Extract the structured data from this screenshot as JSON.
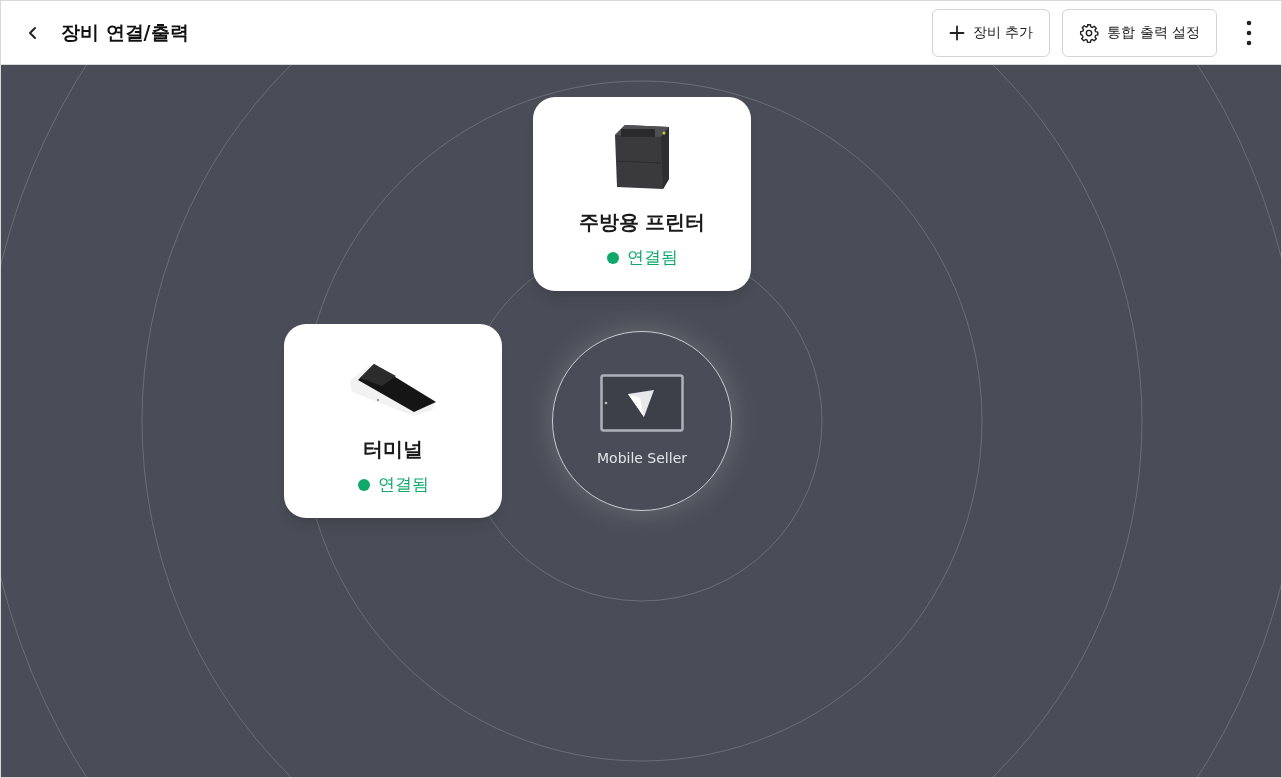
{
  "header": {
    "title": "장비 연결/출력",
    "buttons": [
      {
        "kind": "add",
        "label": "장비 추가"
      },
      {
        "kind": "settings",
        "label": "통합 출력 설정"
      }
    ]
  },
  "hub": {
    "label": "Mobile Seller"
  },
  "devices": [
    {
      "kind": "printer",
      "name": "주방용 프린터",
      "status": "연결됨",
      "connected": true
    },
    {
      "kind": "terminal",
      "name": "터미널",
      "status": "연결됨",
      "connected": true
    }
  ]
}
